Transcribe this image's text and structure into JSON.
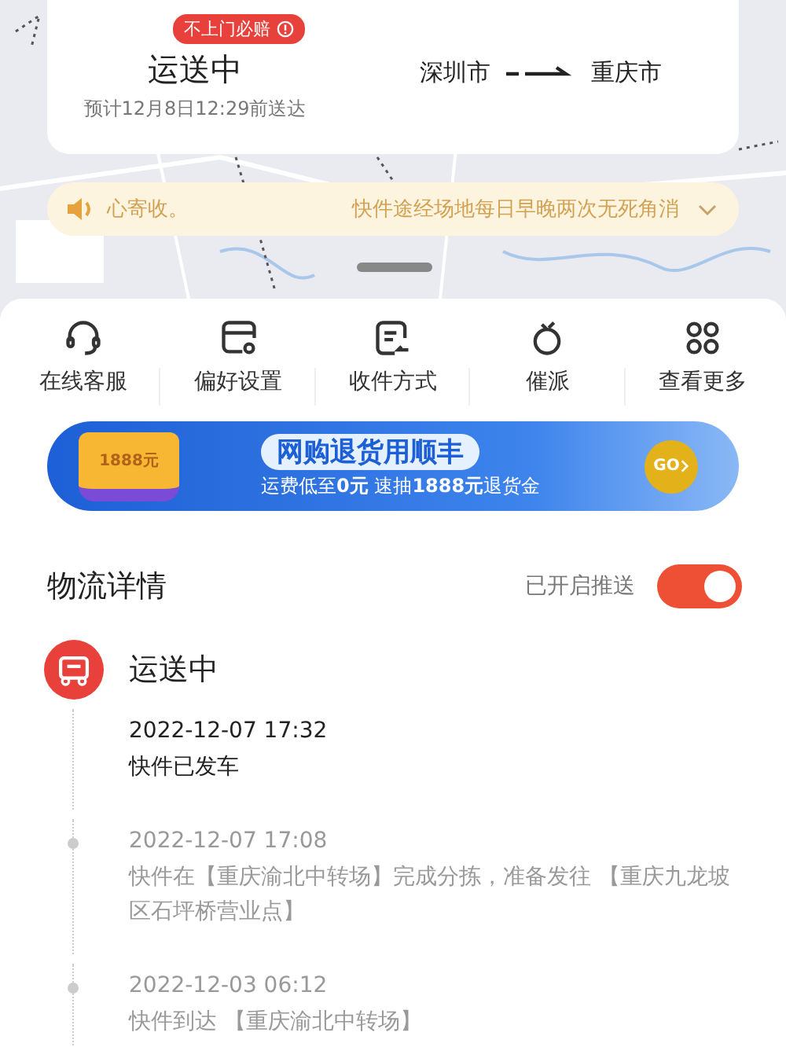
{
  "shipment_card": {
    "badge": "不上门必赔",
    "status": "运送中",
    "eta": "预计12月8日12:29前送达",
    "origin": "深圳市",
    "destination": "重庆市"
  },
  "notice": {
    "text_left": "心寄收。",
    "text_right": "快件途经场地每日早晚两次无死角消",
    "expanded": false
  },
  "actions": [
    {
      "kind": "headset",
      "label": "在线客服"
    },
    {
      "kind": "card",
      "label": "偏好设置"
    },
    {
      "kind": "doc",
      "label": "收件方式"
    },
    {
      "kind": "urge",
      "label": "催派"
    },
    {
      "kind": "grid",
      "label": "查看更多"
    }
  ],
  "banner": {
    "ticket_text": "1888元",
    "title": "网购退货用顺丰",
    "subtitle": "运费低至**0元** 速抽**1888元**退货金",
    "button": "GO"
  },
  "logistics": {
    "title": "物流详情",
    "push_label": "已开启推送",
    "push_on": true,
    "status": "运送中",
    "events": [
      {
        "time": "2022-12-07 17:32",
        "description": "快件已发车",
        "latest": true
      },
      {
        "time": "2022-12-07 17:08",
        "description": "快件在【重庆渝北中转场】完成分拣，准备发往 【重庆九龙坡区石坪桥营业点】",
        "latest": false
      },
      {
        "time": "2022-12-03 06:12",
        "description": "快件到达 【重庆渝北中转场】",
        "latest": false
      }
    ]
  }
}
